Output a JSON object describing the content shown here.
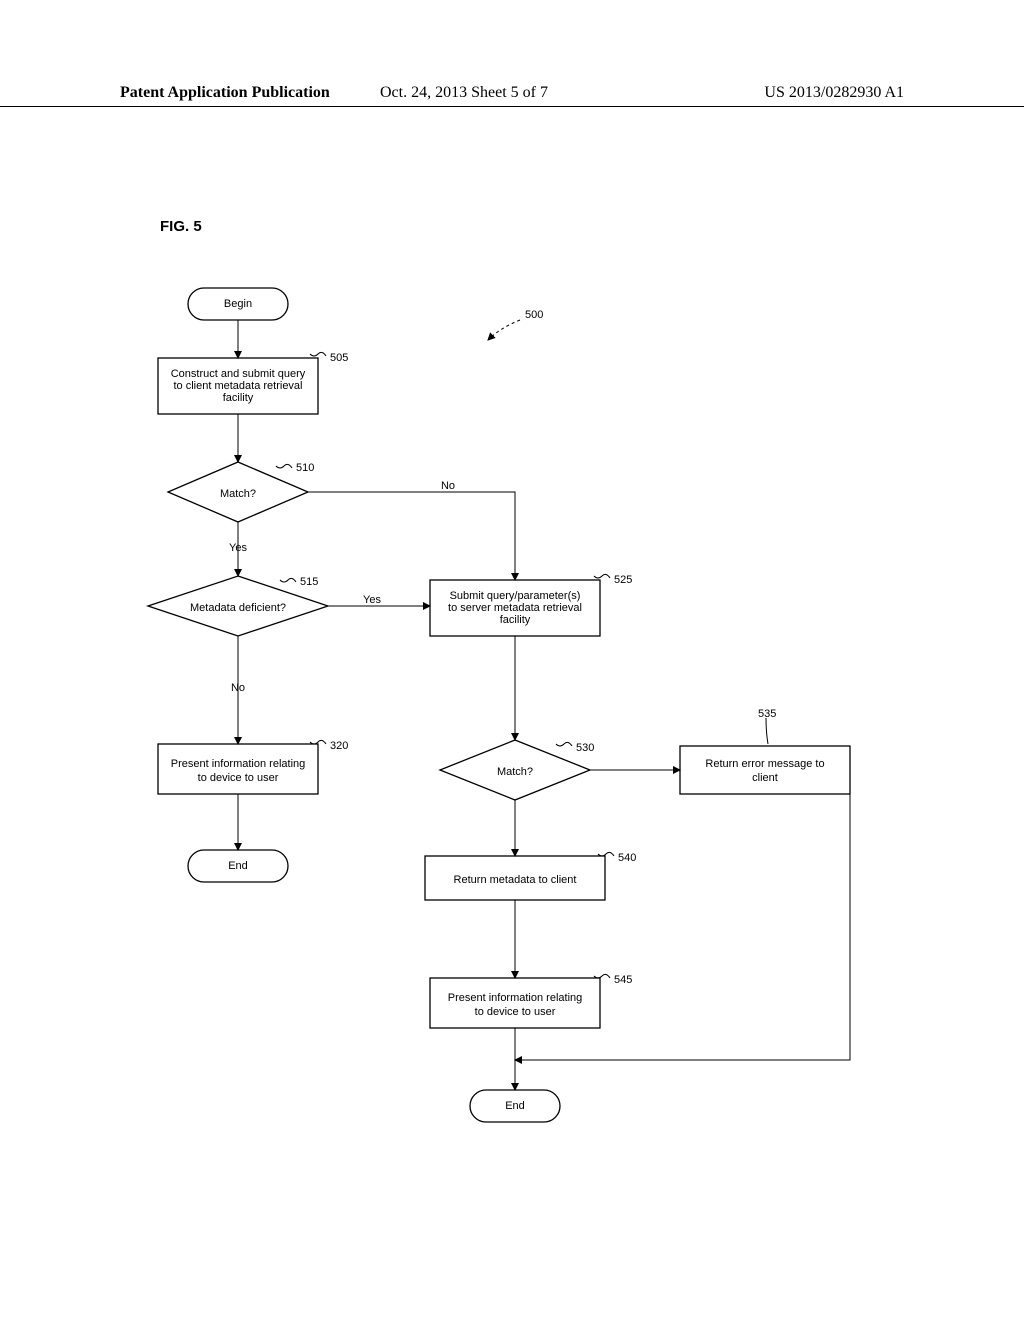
{
  "header": {
    "left": "Patent Application Publication",
    "center": "Oct. 24, 2013  Sheet 5 of 7",
    "right": "US 2013/0282930 A1"
  },
  "figure_label": "FIG. 5",
  "diagram_ref": "500",
  "nodes": {
    "begin": {
      "label": "Begin"
    },
    "n505": {
      "label": "Construct and submit query to client metadata retrieval facility",
      "ref": "505"
    },
    "n510": {
      "label": "Match?",
      "ref": "510"
    },
    "n515": {
      "label": "Metadata deficient?",
      "ref": "515"
    },
    "n320": {
      "label": "Present information relating to device to user",
      "ref": "320"
    },
    "end1": {
      "label": "End"
    },
    "n525": {
      "label": "Submit query/parameter(s) to server metadata retrieval facility",
      "ref": "525"
    },
    "n530": {
      "label": "Match?",
      "ref": "530"
    },
    "n535": {
      "label": "Return error message to client",
      "ref": "535"
    },
    "n540": {
      "label": "Return metadata to client",
      "ref": "540"
    },
    "n545": {
      "label": "Present information relating to device to user",
      "ref": "545"
    },
    "end2": {
      "label": "End"
    }
  },
  "edges": {
    "yes": "Yes",
    "no": "No"
  }
}
